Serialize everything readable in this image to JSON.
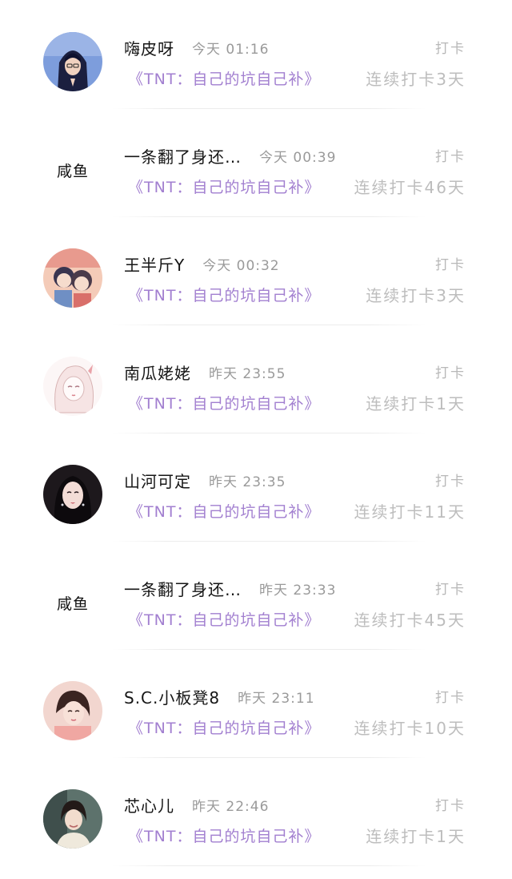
{
  "checkins": [
    {
      "username": "嗨皮呀",
      "time": "今天 01:16",
      "tag": "打卡",
      "book": "《TNT：自己的坑自己补》",
      "streak": "连续打卡3天",
      "avatar": {
        "kind": "hooded-figure-icon",
        "bg": "#6d8fd6"
      }
    },
    {
      "username": "一条翻了身还…",
      "time": "今天 00:39",
      "tag": "打卡",
      "book": "《TNT：自己的坑自己补》",
      "streak": "连续打卡46天",
      "avatar": {
        "kind": "text",
        "text": "咸鱼"
      }
    },
    {
      "username": "王半斤Y",
      "time": "今天 00:32",
      "tag": "打卡",
      "book": "《TNT：自己的坑自己补》",
      "streak": "连续打卡3天",
      "avatar": {
        "kind": "cartoon-duo-icon",
        "bg": "#f3c9b5"
      }
    },
    {
      "username": "南瓜姥姥",
      "time": "昨天 23:55",
      "tag": "打卡",
      "book": "《TNT：自己的坑自己补》",
      "streak": "连续打卡1天",
      "avatar": {
        "kind": "sketch-girl-icon",
        "bg": "#fbf3f3"
      }
    },
    {
      "username": "山河可定",
      "time": "昨天 23:35",
      "tag": "打卡",
      "book": "《TNT：自己的坑自己补》",
      "streak": "连续打卡11天",
      "avatar": {
        "kind": "dark-hair-girl-icon",
        "bg": "#1f1a1e"
      }
    },
    {
      "username": "一条翻了身还…",
      "time": "昨天 23:33",
      "tag": "打卡",
      "book": "《TNT：自己的坑自己补》",
      "streak": "连续打卡45天",
      "avatar": {
        "kind": "text",
        "text": "咸鱼"
      }
    },
    {
      "username": "S.C.小板凳8",
      "time": "昨天 23:11",
      "tag": "打卡",
      "book": "《TNT：自己的坑自己补》",
      "streak": "连续打卡10天",
      "avatar": {
        "kind": "pink-girl-icon",
        "bg": "#f4d6cf"
      }
    },
    {
      "username": "芯心儿",
      "time": "昨天 22:46",
      "tag": "打卡",
      "book": "《TNT：自己的坑自己补》",
      "streak": "连续打卡1天",
      "avatar": {
        "kind": "photo-person-icon",
        "bg": "#5b6f6a"
      }
    }
  ]
}
